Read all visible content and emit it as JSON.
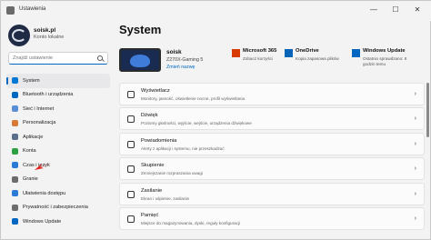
{
  "window": {
    "title": "Ustawienia",
    "min": "—",
    "max": "☐",
    "close": "✕"
  },
  "profile": {
    "name": "soisk.pl",
    "account_type": "Konto lokalne"
  },
  "search": {
    "placeholder": "Znajdź ustawienie"
  },
  "nav": {
    "items": [
      {
        "label": "System",
        "icon": "monitor-icon",
        "color": "#0078d4",
        "active": true
      },
      {
        "label": "Bluetooth i urządzenia",
        "icon": "bluetooth-icon",
        "color": "#0067c0"
      },
      {
        "label": "Sieć i Internet",
        "icon": "wifi-icon",
        "color": "#5a8fd8"
      },
      {
        "label": "Personalizacja",
        "icon": "brush-icon",
        "color": "#d67a35"
      },
      {
        "label": "Aplikacje",
        "icon": "apps-icon",
        "color": "#5c6f8a"
      },
      {
        "label": "Konta",
        "icon": "person-icon",
        "color": "#2ea043"
      },
      {
        "label": "Czas i język",
        "icon": "globe-icon",
        "color": "#2b7bd6"
      },
      {
        "label": "Granie",
        "icon": "gamepad-icon",
        "color": "#6c6c6c"
      },
      {
        "label": "Ułatwienia dostępu",
        "icon": "accessibility-icon",
        "color": "#2b7bd6"
      },
      {
        "label": "Prywatność i zabezpieczenia",
        "icon": "shield-icon",
        "color": "#6c6c6c"
      },
      {
        "label": "Windows Update",
        "icon": "update-icon",
        "color": "#0067c0"
      }
    ]
  },
  "main": {
    "title": "System",
    "device": {
      "name": "soisk",
      "model": "Z270X-Gaming 5",
      "rename": "Zmień nazwę"
    },
    "tiles": [
      {
        "title": "Microsoft 365",
        "sub": "Zobacz korzyści",
        "icon": "microsoft365-icon",
        "color": "#d83b01"
      },
      {
        "title": "OneDrive",
        "sub": "Kopia zapasowa plików",
        "icon": "onedrive-icon",
        "color": "#0364b8"
      },
      {
        "title": "Windows Update",
        "sub": "Ostatnio sprawdzano: 8 godzin temu",
        "icon": "update-icon",
        "color": "#0067c0"
      }
    ],
    "cards": [
      {
        "title": "Wyświetlacz",
        "sub": "Monitory, jasność, oświetlenie nocne, profil wyświetlania",
        "icon": "display-icon"
      },
      {
        "title": "Dźwięk",
        "sub": "Poziomy głośności, wyjście, wejście, urządzenia dźwiękowe",
        "icon": "speaker-icon"
      },
      {
        "title": "Powiadomienia",
        "sub": "Alerty z aplikacji i systemu, nie przeszkadzać",
        "icon": "bell-icon"
      },
      {
        "title": "Skupienie",
        "sub": "Zmniejszanie rozpraszania uwagi",
        "icon": "focus-icon"
      },
      {
        "title": "Zasilanie",
        "sub": "Ekran i uśpienie, zasilanie",
        "icon": "power-icon"
      },
      {
        "title": "Pamięć",
        "sub": "Miejsce do magazynowania, dyski, reguły konfiguracji",
        "icon": "storage-icon"
      }
    ]
  },
  "colors": {
    "accent": "#0067c0",
    "arrow": "#e0241b"
  }
}
